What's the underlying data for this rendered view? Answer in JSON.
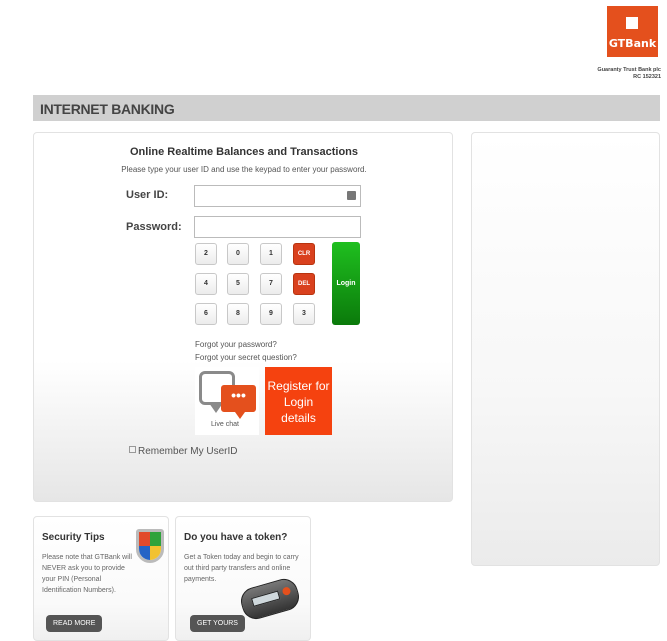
{
  "brand": {
    "logo_text": "GTBank",
    "company_name": "Guaranty Trust Bank plc",
    "rc_number": "RC 152321",
    "accent_color": "#e4501d"
  },
  "banner": {
    "title": "INTERNET BANKING"
  },
  "login_panel": {
    "title": "Online Realtime Balances and Transactions",
    "instruction": "Please type your user ID and use the keypad to enter your password.",
    "user_id_label": "User ID:",
    "user_id_value": "",
    "password_label": "Password:",
    "password_value": "",
    "keypad_row1": [
      "2",
      "0",
      "1"
    ],
    "keypad_row2": [
      "4",
      "5",
      "7"
    ],
    "keypad_row3": [
      "6",
      "8",
      "9",
      "3"
    ],
    "clear_label": "CLR",
    "delete_label": "DEL",
    "login_label": "Login",
    "forgot_password": "Forgot your password?",
    "forgot_question": "Forgot your secret question?",
    "live_chat_label": "Live chat",
    "register_label": "Register for Login details",
    "remember_label": "Remember My UserID",
    "remember_checked": false
  },
  "security_tips": {
    "title": "Security Tips",
    "body": "Please note that GTBank will NEVER ask you to provide your PIN (Personal Identification Numbers).",
    "button": "READ MORE"
  },
  "token_card": {
    "title": "Do you have a token?",
    "body": "Get a Token today and begin to carry out third party transfers and online payments.",
    "button": "GET YOURS"
  }
}
